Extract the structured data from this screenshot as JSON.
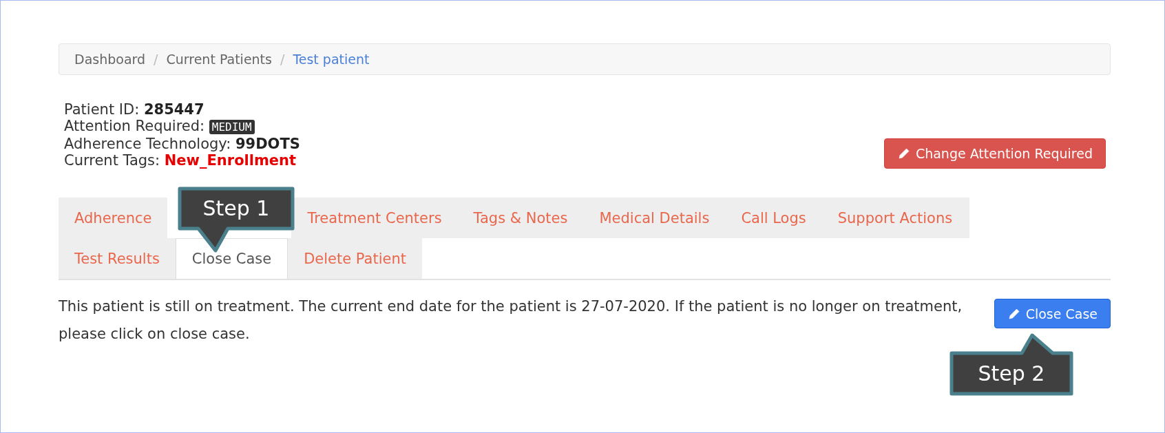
{
  "breadcrumb": [
    {
      "label": "Dashboard",
      "current": false
    },
    {
      "separator": "/",
      "label": "Current Patients",
      "current": false
    },
    {
      "separator": "/",
      "label": "Test patient",
      "current": true
    }
  ],
  "patient_info": [
    {
      "label": "Patient ID:",
      "value": "285447",
      "kind": "bold"
    },
    {
      "label": "Attention Required:",
      "value": "MEDIUM",
      "kind": "badge"
    },
    {
      "label": "Adherence Technology:",
      "value": "99DOTS",
      "kind": "bold"
    },
    {
      "label": "Current Tags:",
      "value": "New_Enrollment",
      "kind": "tag"
    }
  ],
  "change_attention_button": {
    "label": "Change Attention Required"
  },
  "tab_rows": [
    [
      {
        "label": "Adherence",
        "selected": false
      },
      {
        "label": "Treatment Centers",
        "selected": false
      },
      {
        "label": "Tags & Notes",
        "selected": false
      },
      {
        "label": "Medical Details",
        "selected": false
      },
      {
        "label": "Call Logs",
        "selected": false
      },
      {
        "label": "Support Actions",
        "selected": false
      }
    ],
    [
      {
        "label": "Test Results",
        "selected": false
      },
      {
        "label": "Close Case",
        "selected": true
      },
      {
        "label": "Delete Patient",
        "selected": false
      }
    ]
  ],
  "message": "This patient is still on treatment. The current end date for the patient is 27-07-2020. If the patient is no longer on treatment, please click on close case.",
  "close_case_button": {
    "label": "Close Case"
  },
  "callouts": [
    {
      "label": "Step 1",
      "kind": "down"
    },
    {
      "label": "Step 2",
      "kind": "up"
    }
  ]
}
